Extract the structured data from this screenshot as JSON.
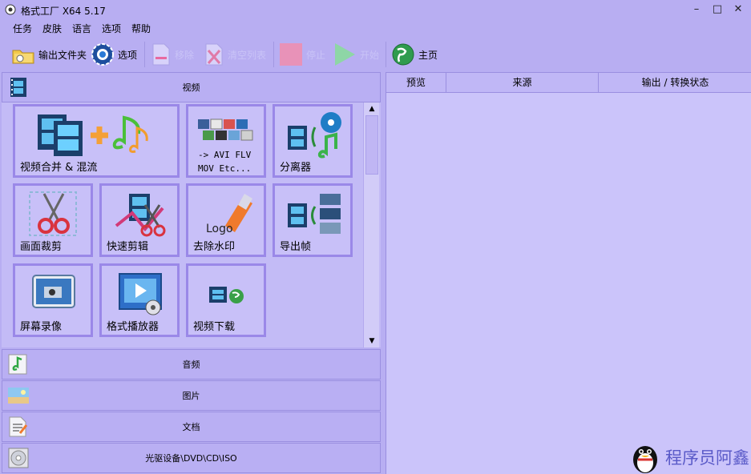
{
  "window": {
    "title": "格式工厂 X64 5.17",
    "controls": [
      "–",
      "□",
      "✕"
    ]
  },
  "menu": {
    "items": [
      "任务",
      "皮肤",
      "语言",
      "选项",
      "帮助"
    ]
  },
  "toolbar": {
    "output_folder": "输出文件夹",
    "options": "选项",
    "remove": "移除",
    "clear_list": "清空列表",
    "stop": "停止",
    "start": "开始",
    "home": "主页"
  },
  "categories": {
    "video": "视频",
    "audio": "音频",
    "image": "图片",
    "document": "文档",
    "rom": "光驱设备\\DVD\\CD\\ISO"
  },
  "tiles": {
    "merge": "视频合并 & 混流",
    "convert_line1": "-> AVI FLV",
    "convert_line2": "MOV Etc...",
    "splitter": "分离器",
    "crop": "画面裁剪",
    "quick_cut": "快速剪辑",
    "remove_watermark": "去除水印",
    "logo_text": "Logo",
    "export_frames": "导出帧",
    "screen_record": "屏幕录像",
    "player": "格式播放器",
    "downloader": "视频下载"
  },
  "task_list": {
    "columns": [
      "预览",
      "来源",
      "输出 / 转换状态"
    ]
  },
  "watermark": {
    "text": "程序员阿鑫"
  },
  "colors": {
    "background": "#b8aef2",
    "tile_border": "#9a88e8",
    "tile_fill": "#c8c0f8",
    "panel": "#cbc4fa"
  }
}
